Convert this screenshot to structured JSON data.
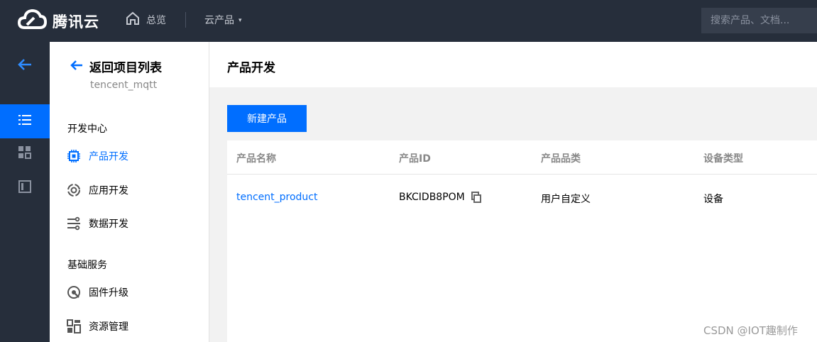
{
  "topbar": {
    "brand": "腾讯云",
    "overview_label": "总览",
    "products_label": "云产品",
    "search_placeholder": "搜索产品、文档..."
  },
  "sidebar": {
    "back_label": "返回项目列表",
    "project_id": "tencent_mqtt",
    "sections": [
      {
        "title": "开发中心",
        "items": [
          {
            "label": "产品开发",
            "icon": "chip-icon",
            "active": true
          },
          {
            "label": "应用开发",
            "icon": "app-dev-icon",
            "active": false
          },
          {
            "label": "数据开发",
            "icon": "data-flow-icon",
            "active": false
          }
        ]
      },
      {
        "title": "基础服务",
        "items": [
          {
            "label": "固件升级",
            "icon": "firmware-icon",
            "active": false
          },
          {
            "label": "资源管理",
            "icon": "resource-icon",
            "active": false
          }
        ]
      }
    ]
  },
  "main": {
    "title": "产品开发",
    "new_button": "新建产品",
    "table": {
      "columns": [
        "产品名称",
        "产品ID",
        "产品品类",
        "设备类型"
      ],
      "rows": [
        {
          "name": "tencent_product",
          "id": "BKCIDB8POM",
          "category": "用户自定义",
          "device_type": "设备"
        }
      ]
    }
  },
  "watermark": "CSDN @IOT趣制作",
  "colors": {
    "accent": "#006eff",
    "topbar_bg": "#262e3b",
    "page_bg": "#f2f2f2"
  }
}
